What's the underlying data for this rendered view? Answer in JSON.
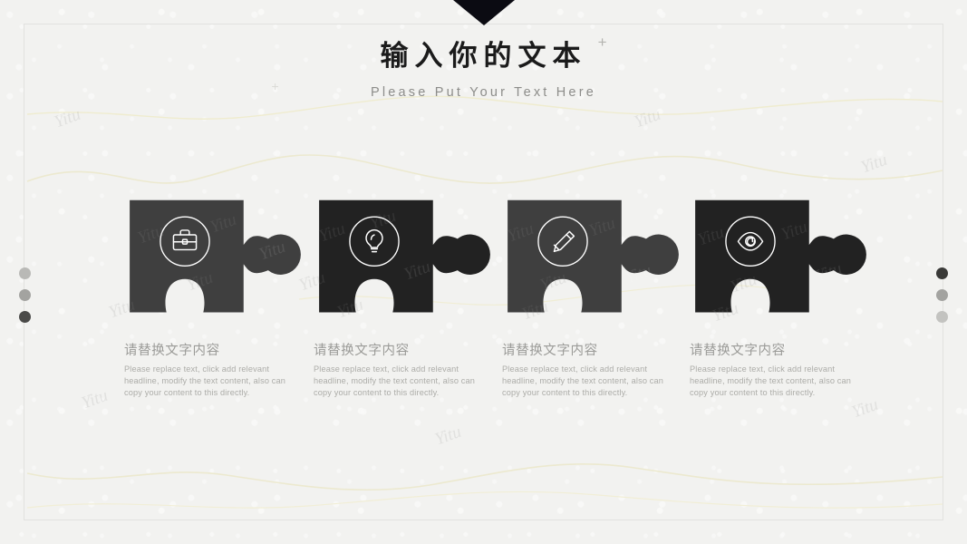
{
  "slide": {
    "background_color": "#f2f2f0",
    "frame_color": "#e2e2df",
    "triangle_color": "#0b0b12",
    "watermark_text": "Yitu"
  },
  "header": {
    "title": "输入你的文本",
    "subtitle": "Please Put Your Text Here",
    "plus_mark": "+",
    "plus_mark_secondary": "+"
  },
  "decorations": {
    "dots_left": [
      {
        "color": "#b9b9b6"
      },
      {
        "color": "#a3a3a0"
      },
      {
        "color": "#4a4a48"
      }
    ],
    "dots_right": [
      {
        "color": "#3a3a38"
      },
      {
        "color": "#a3a3a0"
      },
      {
        "color": "#c3c3c0"
      }
    ]
  },
  "items": [
    {
      "icon": "briefcase-icon",
      "piece_color": "#3f3f3f",
      "heading": "请替换文字内容",
      "body": "Please replace text, click add relevant headline, modify the text content, also can copy your content to this directly."
    },
    {
      "icon": "lightbulb-icon",
      "piece_color": "#222222",
      "heading": "请替换文字内容",
      "body": "Please replace text, click add relevant headline, modify the text content, also can copy your content to this directly."
    },
    {
      "icon": "pencil-icon",
      "piece_color": "#3f3f3f",
      "heading": "请替换文字内容",
      "body": "Please replace text, click add relevant headline, modify the text content, also can copy your content to this directly."
    },
    {
      "icon": "eye-icon",
      "piece_color": "#222222",
      "heading": "请替换文字内容",
      "body": "Please replace text, click add relevant headline, modify the text content, also can copy your content to this directly."
    }
  ]
}
